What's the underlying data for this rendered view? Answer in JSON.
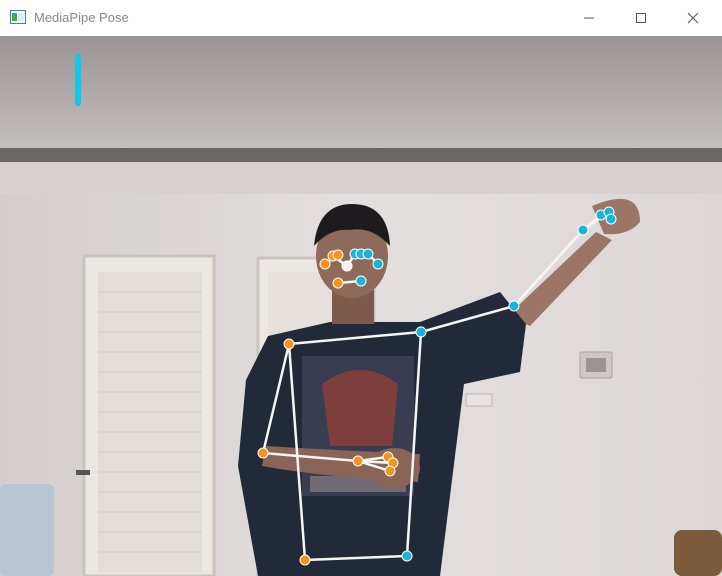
{
  "window": {
    "title": "MediaPipe Pose",
    "icons": {
      "app": "app-window-icon",
      "minimize": "minimize-icon",
      "maximize": "maximize-icon",
      "close": "close-icon"
    }
  },
  "pose": {
    "bar_color": "#16c6e6",
    "left_color": "#f5931f",
    "right_color": "#1ab3dc",
    "nose_color": "#f2f2f2",
    "connection_color": "#f5f5f5",
    "landmark_count": 33
  }
}
